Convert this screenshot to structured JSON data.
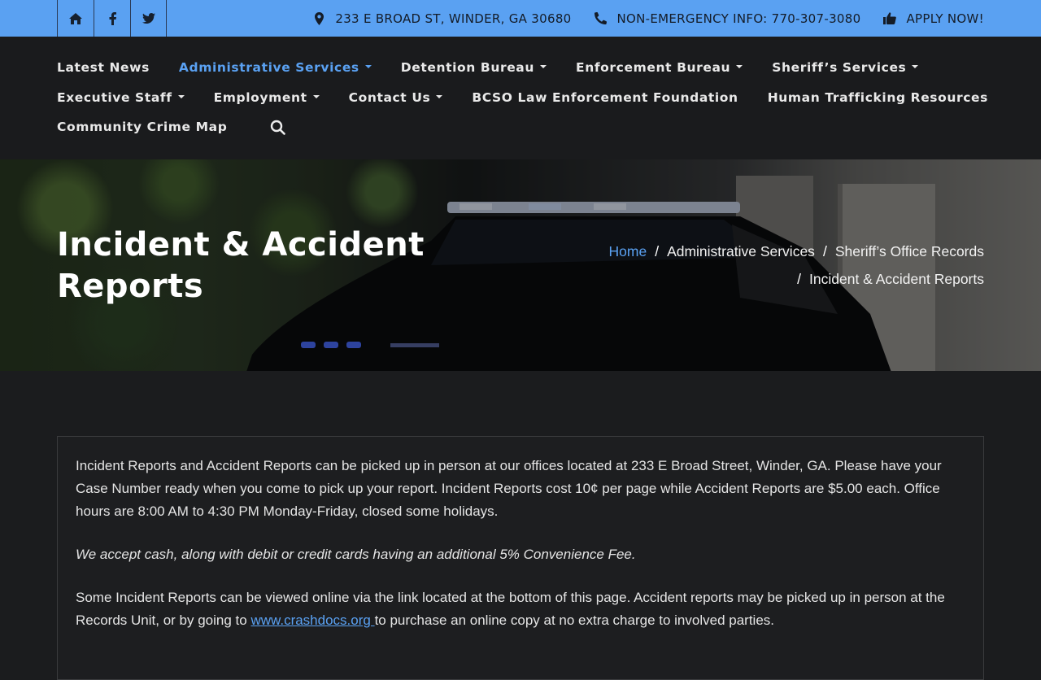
{
  "topbar": {
    "social": [
      {
        "name": "home",
        "icon": "home-icon"
      },
      {
        "name": "facebook",
        "icon": "facebook-icon"
      },
      {
        "name": "twitter",
        "icon": "twitter-icon"
      }
    ],
    "address": "233 E BROAD ST, WINDER, GA 30680",
    "phone": "NON-EMERGENCY INFO: 770-307-3080",
    "apply": "APPLY NOW!",
    "bg_color": "#5aa1f2"
  },
  "nav": {
    "items": [
      {
        "label": "Latest News",
        "dropdown": false,
        "active": false
      },
      {
        "label": "Administrative Services",
        "dropdown": true,
        "active": true
      },
      {
        "label": "Detention Bureau",
        "dropdown": true,
        "active": false
      },
      {
        "label": "Enforcement Bureau",
        "dropdown": true,
        "active": false
      },
      {
        "label": "Sheriff’s Services",
        "dropdown": true,
        "active": false
      },
      {
        "label": "Executive Staff",
        "dropdown": true,
        "active": false
      },
      {
        "label": "Employment",
        "dropdown": true,
        "active": false
      },
      {
        "label": "Contact Us",
        "dropdown": true,
        "active": false
      },
      {
        "label": "BCSO Law Enforcement Foundation",
        "dropdown": false,
        "active": false
      },
      {
        "label": "Human Trafficking Resources",
        "dropdown": false,
        "active": false
      },
      {
        "label": "Community Crime Map",
        "dropdown": false,
        "active": false
      }
    ],
    "search_icon": "search-icon",
    "active_color": "#5aa1f2"
  },
  "hero": {
    "title": "Incident & Accident Reports",
    "breadcrumb": {
      "home": "Home",
      "items": [
        "Administrative Services",
        "Sheriff’s Office Records",
        "Incident & Accident Reports"
      ]
    }
  },
  "content": {
    "p1": "Incident Reports and Accident Reports can be picked up in person at our offices located at 233 E Broad Street, Winder, GA. Please have your Case Number ready when you come to pick up your report. Incident Reports cost 10¢ per page while Accident Reports are $5.00 each. Office hours are 8:00 AM to 4:30 PM Monday-Friday, closed some holidays.",
    "p2": "We accept cash, along with debit or credit cards having an additional 5% Convenience Fee.",
    "p3_before": "Some Incident Reports can be viewed online via the link located at the bottom of this page. Accident reports may be picked up in person at the Records Unit, or by going to ",
    "p3_link": "www.crashdocs.org ",
    "p3_after": "to purchase an online copy at no extra charge to involved parties."
  }
}
